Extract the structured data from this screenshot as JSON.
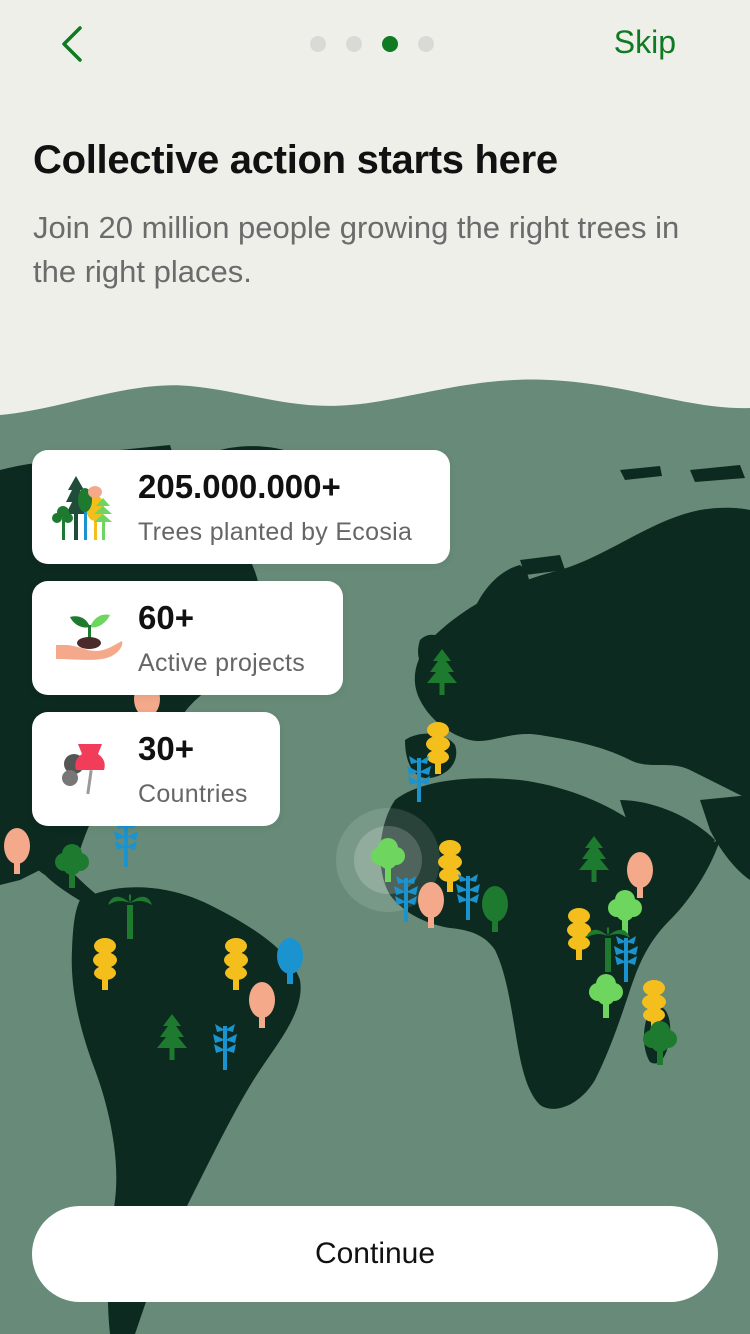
{
  "header": {
    "skip_label": "Skip",
    "back_icon": "chevron-left-icon",
    "pages": 4,
    "active_page": 3
  },
  "onboarding": {
    "title": "Collective action starts here",
    "subtitle": "Join 20 million people growing the right trees in the right places."
  },
  "stats": [
    {
      "value": "205.000.000+",
      "label": "Trees planted by Ecosia",
      "icon": "trees-icon"
    },
    {
      "value": "60+",
      "label": "Active projects",
      "icon": "seedling-hand-icon"
    },
    {
      "value": "30+",
      "label": "Countries",
      "icon": "pushpin-icon"
    }
  ],
  "footer": {
    "continue_label": "Continue"
  },
  "colors": {
    "accent": "#0f7a21",
    "background": "#efefea",
    "ocean": "#678b78",
    "land": "#0c2a1f",
    "tree_yellow": "#f4bf1d",
    "tree_blue": "#1a93cf",
    "tree_peach": "#f4a98a",
    "tree_green": "#1d7a2f",
    "tree_lightgreen": "#6ed65e"
  }
}
